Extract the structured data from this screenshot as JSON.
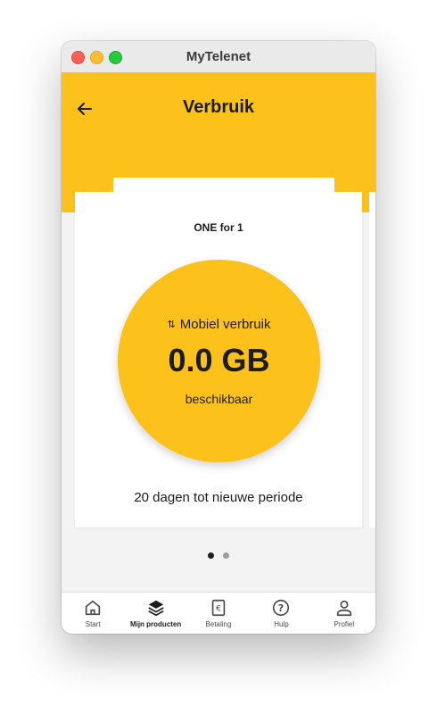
{
  "window": {
    "title": "MyTelenet"
  },
  "header": {
    "title": "Verbruik"
  },
  "card": {
    "plan_name": "ONE for 1",
    "usage_label": "Mobiel verbruik",
    "usage_icon": "up-down-arrows-icon",
    "usage_value": "0.0 GB",
    "usage_sub": "beschikbaar",
    "period_text": "20 dagen tot nieuwe periode"
  },
  "pagination": {
    "count": 2,
    "active_index": 0
  },
  "tabbar": {
    "items": [
      {
        "label": "Start",
        "icon": "home-icon",
        "active": false
      },
      {
        "label": "Mijn producten",
        "icon": "layers-icon",
        "active": true
      },
      {
        "label": "Betaling",
        "icon": "euro-receipt-icon",
        "active": false
      },
      {
        "label": "Hulp",
        "icon": "help-circle-icon",
        "active": false
      },
      {
        "label": "Profiel",
        "icon": "user-icon",
        "active": false
      }
    ]
  },
  "colors": {
    "brand_yellow": "#fcc21b",
    "text_dark": "#1c1c1c",
    "background": "#f3f3f3"
  }
}
